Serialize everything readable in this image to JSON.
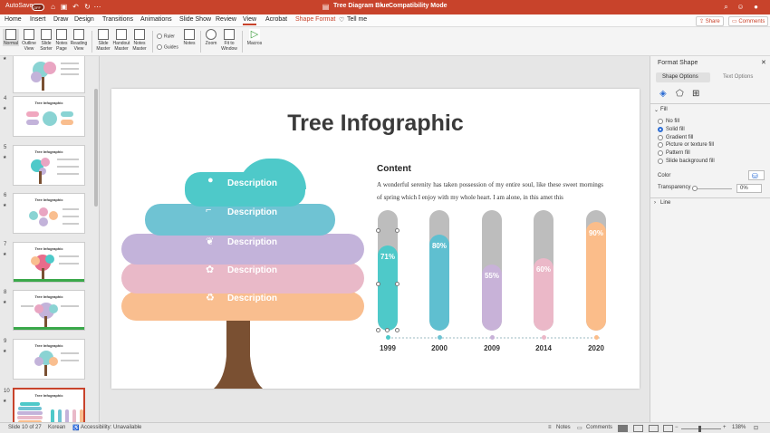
{
  "titlebar": {
    "autosave_label": "AutoSave",
    "autosave_state": "OFF",
    "doc_title": "Tree Diagram Blue",
    "doc_sep": "•",
    "mode": "Compatibility Mode"
  },
  "menu": {
    "tabs": [
      "Home",
      "Insert",
      "Draw",
      "Design",
      "Transitions",
      "Animations",
      "Slide Show",
      "Review",
      "View",
      "Acrobat",
      "Shape Format"
    ],
    "active": "View",
    "tell_me": "Tell me",
    "share_label": "Share",
    "comments_label": "Comments"
  },
  "ribbon": {
    "presentation_views": [
      "Normal",
      "Outline View",
      "Slide Sorter",
      "Notes Page",
      "Reading View"
    ],
    "master_views": [
      "Slide Master",
      "Handout Master",
      "Notes Master"
    ],
    "ruler": "Ruler",
    "guides": "Guides",
    "notes": "Notes",
    "zoom": "Zoom",
    "fit": "Fit to Window",
    "macros": "Macros"
  },
  "thumbnails": {
    "title": "Tree Infographic",
    "numbers": [
      "4",
      "5",
      "6",
      "7",
      "8",
      "9",
      "10"
    ],
    "selected": "10"
  },
  "slide": {
    "title": "Tree Infographic",
    "tree_layers": [
      {
        "label": "Description",
        "color": "#4ec9c9",
        "icon": "water-drop-icon"
      },
      {
        "label": "Description",
        "color": "#6fc3d3",
        "icon": "faucet-icon"
      },
      {
        "label": "Description",
        "color": "#c3b3da",
        "icon": "leaf-icon"
      },
      {
        "label": "Description",
        "color": "#e9b9c8",
        "icon": "seedling-icon"
      },
      {
        "label": "Description",
        "color": "#f9be8f",
        "icon": "recycle-icon"
      }
    ],
    "trunk_color": "#7a5032",
    "content_heading": "Content",
    "content_text": "A wonderful serenity has taken possession of my entire soul, like these sweet mornings of spring which I enjoy with my whole heart. I am alone, in this amet this"
  },
  "chart_data": {
    "type": "bar",
    "categories": [
      "1999",
      "2000",
      "2009",
      "2014",
      "2020"
    ],
    "values": [
      71,
      80,
      55,
      60,
      90
    ],
    "value_labels": [
      "71%",
      "80%",
      "55%",
      "60%",
      "90%"
    ],
    "colors": [
      "#4ec9c9",
      "#5fbfd0",
      "#c8b2d8",
      "#ebb8c8",
      "#fbbd8a"
    ],
    "ylim": [
      0,
      100
    ],
    "track_color": "#bdbdbd",
    "title": "",
    "xlabel": "",
    "ylabel": ""
  },
  "pane": {
    "title": "Format Shape",
    "tabs": [
      "Shape Options",
      "Text Options"
    ],
    "section_fill": "Fill",
    "fill_options": [
      "No fill",
      "Solid fill",
      "Gradient fill",
      "Picture or texture fill",
      "Pattern fill",
      "Slide background fill"
    ],
    "selected_fill": "Solid fill",
    "color_label": "Color",
    "transparency_label": "Transparency",
    "transparency_value": "0%",
    "section_line": "Line"
  },
  "status": {
    "slide": "Slide 10 of 27",
    "language": "Korean",
    "accessibility": "Accessibility: Unavailable",
    "notes": "Notes",
    "comments": "Comments",
    "zoom": "138%"
  }
}
